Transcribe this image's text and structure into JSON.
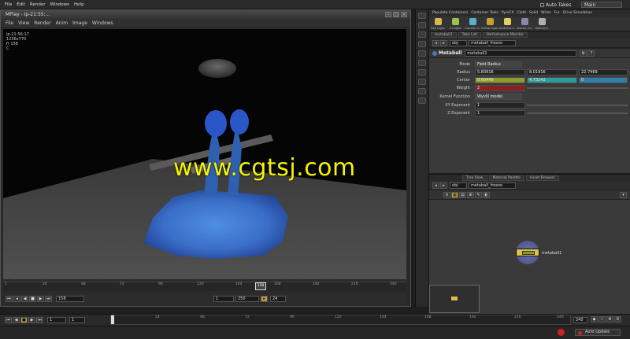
{
  "topbar": {
    "menus": [
      "File",
      "Edit",
      "Render",
      "Windows",
      "Help"
    ],
    "auto_takes": "Auto Takes",
    "desktop": "Main"
  },
  "mplay": {
    "title": "MPlay - ip-21:55:...",
    "menus": [
      "File",
      "View",
      "Render",
      "Anim",
      "Image",
      "Windows"
    ],
    "info_lines": [
      "ip-21:56:17",
      "1236x770",
      "fr 158",
      "C"
    ],
    "timeline_ticks": [
      "1",
      "24",
      "48",
      "72",
      "96",
      "120",
      "144",
      "168",
      "192",
      "216",
      "240"
    ],
    "current_frame_marker": "158",
    "frame_field": "158",
    "range_start": "1",
    "range_end": "250",
    "fps": "24"
  },
  "shelf": {
    "tabs": [
      "Populate Containers",
      "Container Tools",
      "PyroFX",
      "Cloth",
      "Solid",
      "Wires",
      "Fur",
      "Drive Simulation"
    ],
    "tools": [
      {
        "label": "Sky Light",
        "color": "#d8b84a"
      },
      {
        "label": "GI Light",
        "color": "#9bc24a"
      },
      {
        "label": "Caustic Li.",
        "color": "#5ab0c8"
      },
      {
        "label": "Portal Light",
        "color": "#c8a030"
      },
      {
        "label": "Ambient L.",
        "color": "#e0d060"
      },
      {
        "label": "Stereo Ca.",
        "color": "#8a8aa8"
      },
      {
        "label": "Switcher",
        "color": "#b0b0b0"
      }
    ]
  },
  "params": {
    "tabs": [
      "metaball1",
      "Take List",
      "Performance Monitor"
    ],
    "path_obj": "obj",
    "path_node": "metaball_freeze",
    "node_type": "Metaball",
    "node_name": "metaball1",
    "rows": [
      {
        "label": "Mode",
        "values": [
          "Field Radius"
        ]
      },
      {
        "label": "Radius",
        "values": [
          "5.83916",
          "8.01916",
          "22.7469"
        ]
      },
      {
        "label": "Center",
        "values": [
          "0.60449",
          "4.73242",
          "0"
        ]
      },
      {
        "label": "Weight",
        "values": [
          "2"
        ]
      },
      {
        "label": "Kernel Function",
        "values": [
          "Wyvill model"
        ]
      },
      {
        "label": "XY Exponent",
        "values": [
          "1"
        ]
      },
      {
        "label": "Z Exponent",
        "values": [
          "1"
        ]
      }
    ]
  },
  "network": {
    "tabs": [
      "Tree View",
      "Material Palette",
      "Asset Browser"
    ],
    "path_obj": "obj",
    "path_node": "metaball_freeze",
    "node_label": "metaball1"
  },
  "global": {
    "frame": "1",
    "start": "1",
    "ticks": [
      "1",
      "24",
      "48",
      "72",
      "96",
      "120",
      "144",
      "168",
      "192",
      "216",
      "240"
    ],
    "end": "240",
    "auto_update": "Auto Update"
  },
  "watermark": "www.cgtsj.com",
  "colors": {
    "center_x": "#8e9a2a",
    "center_y": "#2e9a9a",
    "center_z": "#2f7fa8",
    "weight": "#8c2020",
    "accent": "#b89a3a"
  }
}
